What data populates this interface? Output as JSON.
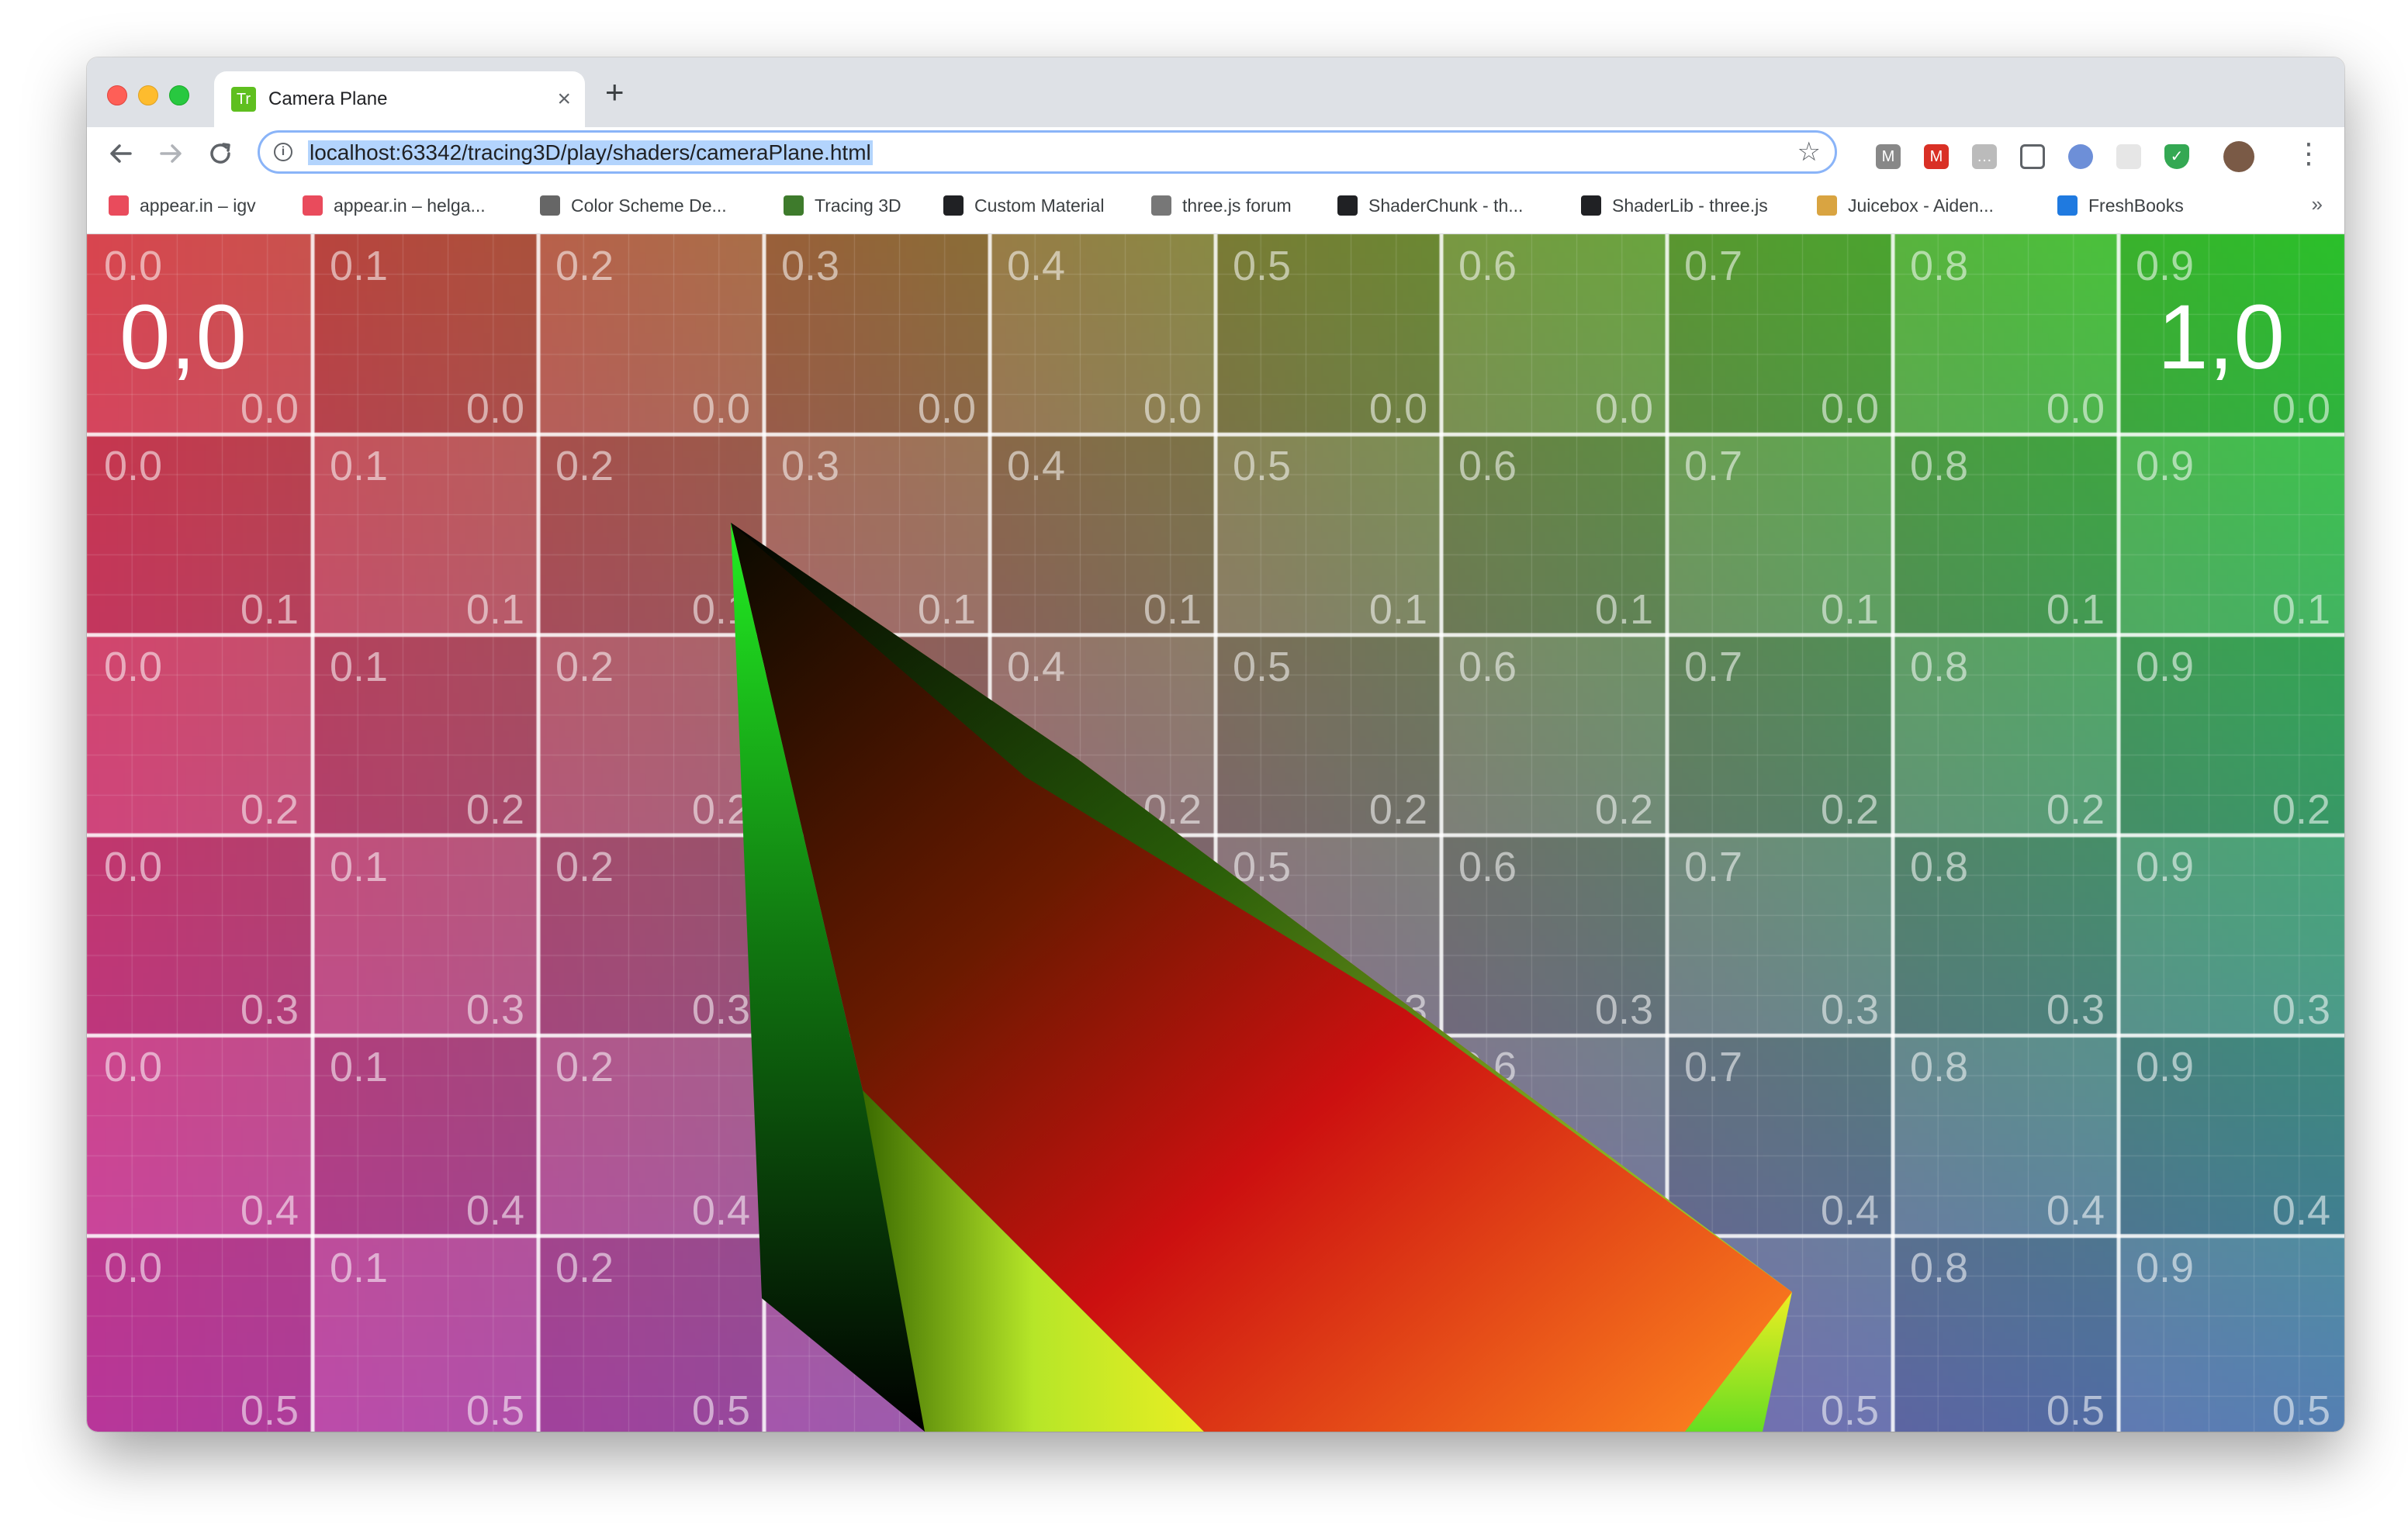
{
  "window": {
    "tab_title": "Camera Plane",
    "tab_favicon_text": "Tr",
    "close_symbol": "×",
    "new_tab_symbol": "+"
  },
  "toolbar": {
    "back_icon": "arrow-left-icon",
    "forward_icon": "arrow-right-icon",
    "reload_icon": "reload-icon",
    "url": "localhost:63342/tracing3D/play/shaders/cameraPlane.html",
    "info_symbol": "i",
    "star_symbol": "☆",
    "menu_symbol": "⋮"
  },
  "bookmarks": {
    "items": [
      {
        "label": "appear.in – igv",
        "icon_color": "#e94b5c"
      },
      {
        "label": "appear.in – helga...",
        "icon_color": "#e94b5c"
      },
      {
        "label": "Color Scheme De...",
        "icon_color": "#666666"
      },
      {
        "label": "Tracing 3D",
        "icon_color": "#3e7b2c"
      },
      {
        "label": "Custom Material",
        "icon_color": "#202124"
      },
      {
        "label": "three.js forum",
        "icon_color": "#777777"
      },
      {
        "label": "ShaderChunk - th...",
        "icon_color": "#202124"
      },
      {
        "label": "ShaderLib - three.js",
        "icon_color": "#202124"
      },
      {
        "label": "Juicebox - Aiden...",
        "icon_color": "#d9a441"
      },
      {
        "label": "FreshBooks",
        "icon_color": "#1f7ae0"
      }
    ],
    "more_symbol": "»"
  },
  "grid": {
    "columns": [
      "0.0",
      "0.1",
      "0.2",
      "0.3",
      "0.4",
      "0.5",
      "0.6",
      "0.7",
      "0.8",
      "0.9"
    ],
    "rows": [
      "0.0",
      "0.1",
      "0.2",
      "0.3",
      "0.4",
      "0.5"
    ],
    "corner_labels": {
      "top_left": "0,0",
      "top_right": "1,0"
    },
    "colors": {
      "top_left": "#d63a44",
      "top_right": "#2dcc2d",
      "bottom_left": "#c43aa4",
      "bottom_right": "#4a78b0"
    }
  },
  "cube": {
    "colors": [
      "#000000",
      "#22ee22",
      "#cc0000",
      "#eeee22",
      "#ff7722"
    ]
  }
}
